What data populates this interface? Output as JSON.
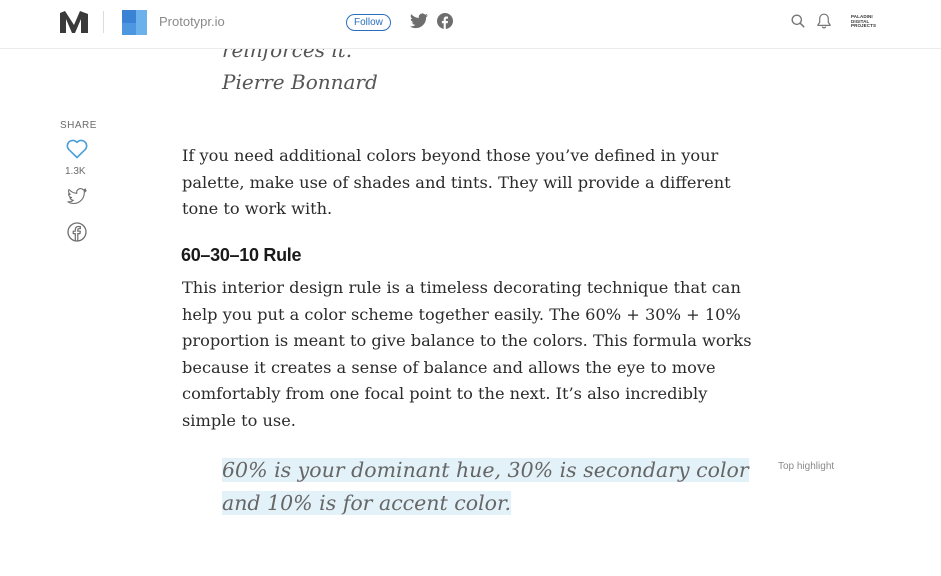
{
  "topbar": {
    "publication_name": "Prototypr.io",
    "follow_label": "Follow",
    "avatar_text": "PALADINI DIGITAL PROJECTS",
    "avatar_lines": [
      "PALADINI",
      "DIGITAL",
      "PROJECTS"
    ],
    "icons": [
      "medium-logo",
      "prototypr-logo",
      "twitter-icon",
      "facebook-icon",
      "search-icon",
      "bell-icon"
    ]
  },
  "share": {
    "label": "SHARE",
    "clap_count": "1.3K",
    "icons": [
      "heart-icon",
      "twitter-icon",
      "facebook-icon"
    ]
  },
  "article": {
    "quote_tail": "reinforces it.",
    "quote_author": "Pierre Bonnard",
    "paragraph_1": "If you need additional colors beyond those you’ve defined in your palette, make use of shades and tints. They will provide a different tone to work with.",
    "heading": "60–30–10 Rule",
    "paragraph_2": "This interior design rule is a timeless decorating technique that can help you put a color scheme together easily. The 60% + 30% + 10% proportion is meant to give balance to the colors. This formula works because it creates a sense of balance and allows the eye to move comfortably from one focal point to the next. It’s also incredibly simple to use.",
    "pull_quote": "60% is your dominant hue, 30% is secondary color and 10% is for accent color.",
    "highlight_label": "Top highlight"
  },
  "colors": {
    "accent_blue": "#2a6fbb",
    "heart_blue": "#4a9fd8",
    "highlight_bg": "#e3f1f8",
    "text": "#2b2b2b"
  }
}
